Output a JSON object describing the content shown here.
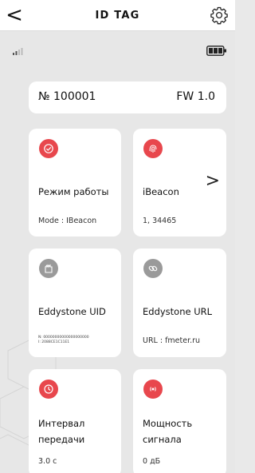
{
  "header": {
    "back_label": "<",
    "title": "ID TAG",
    "settings_icon": "gear-icon"
  },
  "status": {
    "signal_icon": "signal-bars-icon",
    "battery_icon": "battery-icon"
  },
  "device": {
    "number": "№ 100001",
    "firmware": "FW 1.0"
  },
  "cards": {
    "mode": {
      "title": "Режим работы",
      "sub": "Mode : IBeacon",
      "icon": "check-circle-icon"
    },
    "ibeacon": {
      "title": "iBeacon",
      "sub": "1, 34465",
      "icon": "fingerprint-icon",
      "chevron": ">"
    },
    "eddystone_uid": {
      "title": "Eddystone UID",
      "line1": "N: 00000000000000000000",
      "line2": "I: 2088CE1C11E1",
      "icon": "building-icon"
    },
    "eddystone_url": {
      "title": "Eddystone URL",
      "sub": "URL : fmeter.ru",
      "icon": "link-icon"
    },
    "interval": {
      "title_line1": "Интервал",
      "title_line2": "передачи",
      "sub": "3.0 с",
      "icon": "clock-icon"
    },
    "power": {
      "title_line1": "Мощность",
      "title_line2": "сигнала",
      "sub": "0 дБ",
      "icon": "broadcast-icon"
    }
  },
  "colors": {
    "accent_red": "#e8474d",
    "inactive_grey": "#9a9a9a",
    "background": "#e7e7e7"
  }
}
